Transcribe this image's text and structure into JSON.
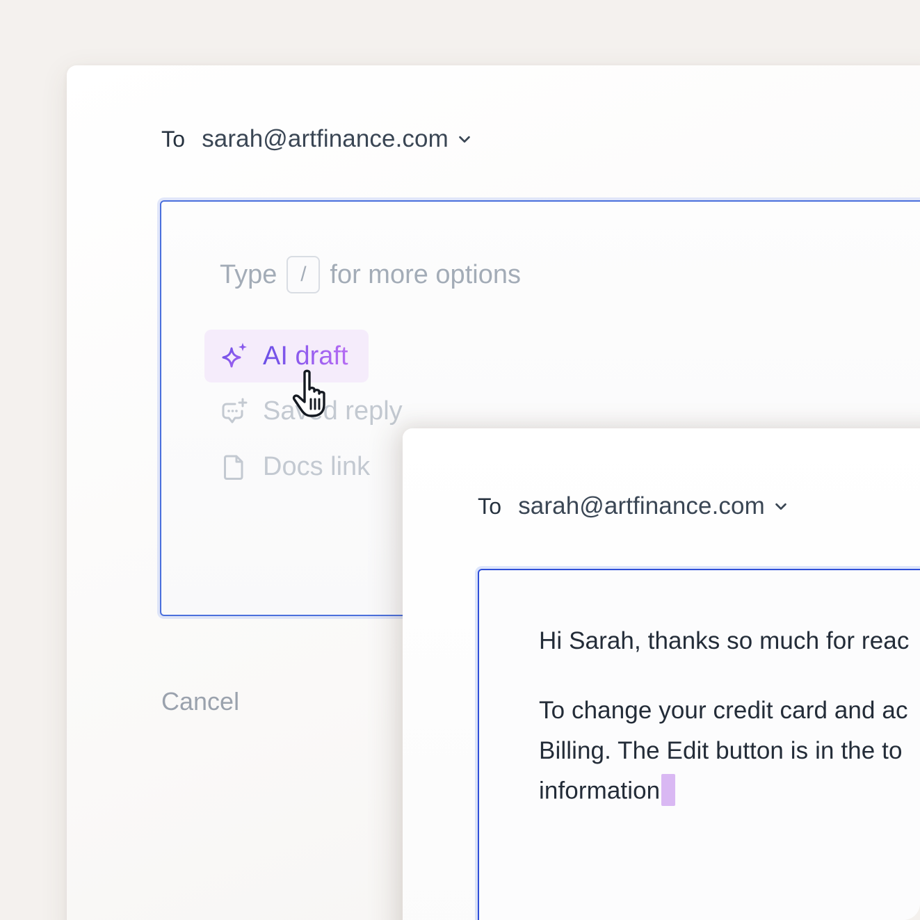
{
  "back_compose": {
    "to_label": "To",
    "to_address": "sarah@artfinance.com",
    "hint_prefix": "Type",
    "hint_key": "/",
    "hint_suffix": "for more options",
    "menu": [
      {
        "label": "AI draft",
        "icon": "sparkle-icon"
      },
      {
        "label": "Saved reply",
        "icon": "chat-add-icon"
      },
      {
        "label": "Docs link",
        "icon": "document-icon"
      }
    ],
    "cancel_label": "Cancel"
  },
  "front_compose": {
    "to_label": "To",
    "to_address": "sarah@artfinance.com",
    "lines": [
      "Hi Sarah, thanks so much for reac",
      "To change your credit card and ac",
      "Billing. The Edit button is in the to",
      "information"
    ]
  },
  "colors": {
    "accent_blue": "#2f4fd8",
    "ai_purple": "#7b55ea",
    "ai_highlight": "#f5ecfb"
  }
}
